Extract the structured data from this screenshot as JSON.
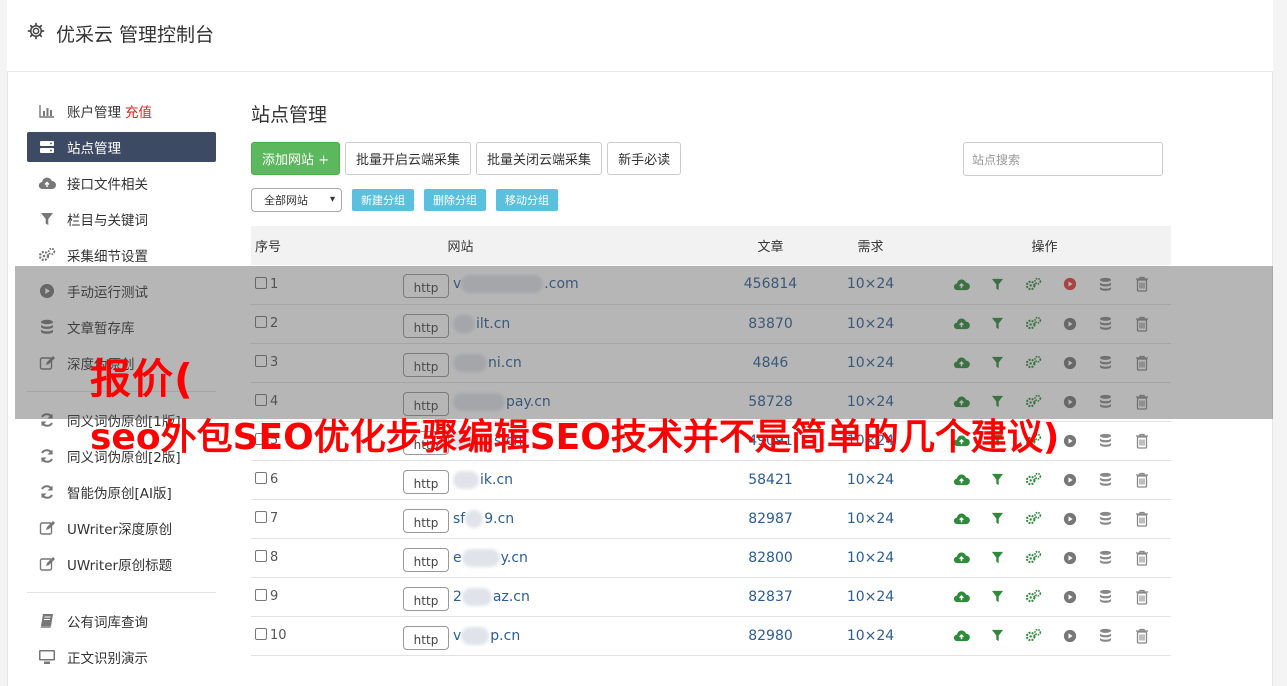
{
  "header": {
    "title": "优采云 管理控制台"
  },
  "sidebar": {
    "items": [
      {
        "label": "账户管理",
        "icon": "bar-chart-icon",
        "extra": "充值"
      },
      {
        "label": "站点管理",
        "icon": "server-icon",
        "active": true
      },
      {
        "label": "接口文件相关",
        "icon": "cloud-upload-icon"
      },
      {
        "label": "栏目与关键词",
        "icon": "filter-icon"
      },
      {
        "label": "采集细节设置",
        "icon": "gears-icon"
      },
      {
        "label": "手动运行测试",
        "icon": "play-circle-icon"
      },
      {
        "label": "文章暂存库",
        "icon": "database-icon"
      },
      {
        "label": "深度伪原创",
        "icon": "edit-icon"
      }
    ],
    "items2": [
      {
        "label": "同义词伪原创[1版]",
        "icon": "refresh-icon"
      },
      {
        "label": "同义词伪原创[2版]",
        "icon": "refresh-icon"
      },
      {
        "label": "智能伪原创[AI版]",
        "icon": "refresh-icon"
      },
      {
        "label": "UWriter深度原创",
        "icon": "edit-icon"
      },
      {
        "label": "UWriter原创标题",
        "icon": "edit-icon"
      }
    ],
    "items3": [
      {
        "label": "公有词库查询",
        "icon": "book-icon"
      },
      {
        "label": "正文识别演示",
        "icon": "monitor-icon"
      }
    ]
  },
  "main": {
    "title": "站点管理",
    "add_button": "添加网站 +",
    "batch_open": "批量开启云端采集",
    "batch_close": "批量关闭云端采集",
    "guide": "新手必读",
    "search_placeholder": "站点搜索",
    "group_select": "全部网站",
    "new_group": "新建分组",
    "delete_group": "删除分组",
    "move_group": "移动分组"
  },
  "table": {
    "headers": {
      "idx": "序号",
      "site": "网站",
      "articles": "文章",
      "demand": "需求",
      "ops": "操作"
    },
    "rows": [
      {
        "idx": "1",
        "proto": "http",
        "prefix": "v",
        "suffix": ".com",
        "articles": "456814",
        "demand": "10×24"
      },
      {
        "idx": "2",
        "proto": "http",
        "prefix": "",
        "suffix": "ilt.cn",
        "articles": "83870",
        "demand": "10×24"
      },
      {
        "idx": "3",
        "proto": "http",
        "prefix": "",
        "suffix": "ni.cn",
        "articles": "4846",
        "demand": "10×24"
      },
      {
        "idx": "4",
        "proto": "http",
        "prefix": "",
        "suffix": "pay.cn",
        "articles": "58728",
        "demand": "10×24"
      },
      {
        "idx": "5",
        "proto": "http",
        "prefix": "",
        "suffix": "s.cn",
        "articles": "49091",
        "demand": "10×24"
      },
      {
        "idx": "6",
        "proto": "http",
        "prefix": "",
        "suffix": "ik.cn",
        "articles": "58421",
        "demand": "10×24"
      },
      {
        "idx": "7",
        "proto": "http",
        "prefix": "sf",
        "suffix": "9.cn",
        "articles": "82987",
        "demand": "10×24"
      },
      {
        "idx": "8",
        "proto": "http",
        "prefix": "e",
        "suffix": "y.cn",
        "articles": "82800",
        "demand": "10×24"
      },
      {
        "idx": "9",
        "proto": "http",
        "prefix": "2",
        "suffix": "az.cn",
        "articles": "82837",
        "demand": "10×24"
      },
      {
        "idx": "10",
        "proto": "http",
        "prefix": "v",
        "suffix": "p.cn",
        "articles": "82980",
        "demand": "10×24"
      }
    ]
  },
  "banner": {
    "line1": "报价(",
    "line2": "seo外包SEO优化步骤编辑SEO技术并不是简单的几个建议)"
  },
  "colors": {
    "accent_green": "#5cb85c",
    "info_blue": "#5bc0de",
    "active_nav": "#3c4a63",
    "banner_red": "#ff0000"
  }
}
